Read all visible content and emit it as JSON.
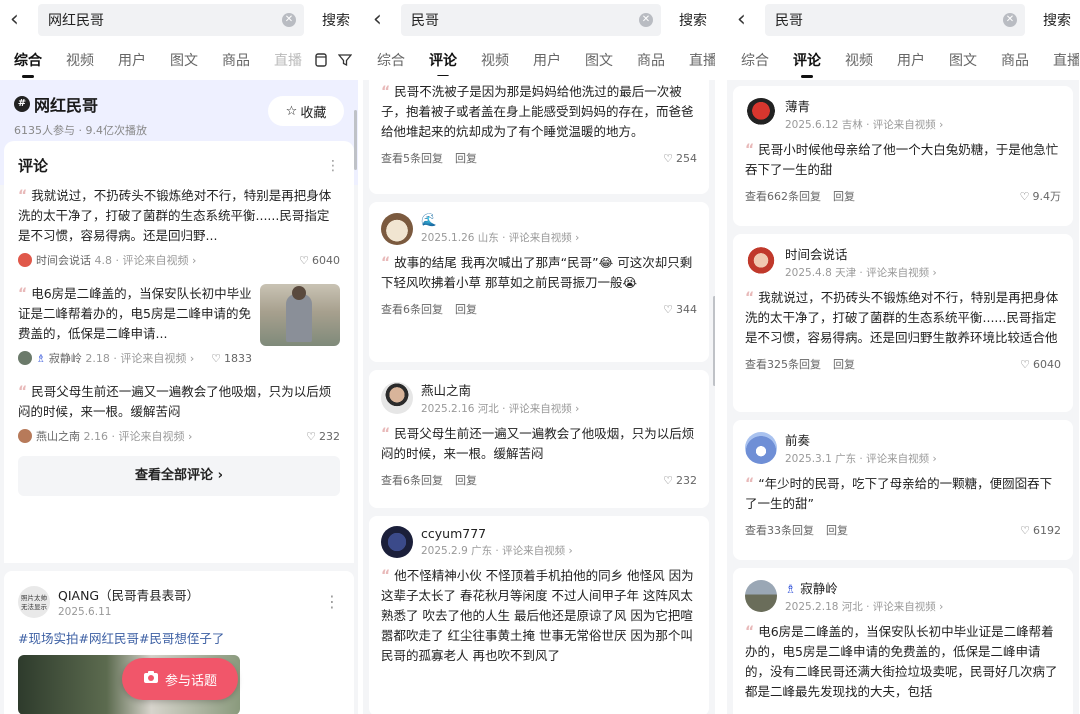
{
  "left": {
    "search": {
      "query": "网红民哥",
      "button": "搜索"
    },
    "tabs": [
      "综合",
      "视频",
      "用户",
      "图文",
      "商品",
      "直播"
    ],
    "topic": {
      "title": "网红民哥",
      "stats": "6135人参与 · 9.4亿次播放",
      "collect": "收藏"
    },
    "comment_section_title": "评论",
    "comments": [
      {
        "text": "我就说过，不扔砖头不锻炼绝对不行，特别是再把身体洗的太干净了，打破了菌群的生态系统平衡......民哥指定是不习惯，容易得病。还是回归野...",
        "user": "时间会说话",
        "meta": "4.8 · 评论来自视频",
        "likes": "6040"
      },
      {
        "text": "电6房是二峰盖的，当保安队长初中毕业证是二峰帮着办的，电5房是二峰申请的免费盖的，低保是二峰申请...",
        "user": "寂静岭",
        "meta": "2.18 · 评论来自视频",
        "likes": "1833"
      },
      {
        "text": "民哥父母生前还一遍又一遍教会了他吸烟，只为以后烦闷的时候，来一根。缓解苦闷",
        "user": "燕山之南",
        "meta": "2.16 · 评论来自视频",
        "likes": "232"
      }
    ],
    "view_all": "查看全部评论",
    "post": {
      "avatar_text": "照片太帅 无法显示",
      "user": "QIANG（民哥青县表哥）",
      "date": "2025.6.11",
      "hashtags": "#现场实拍#网红民哥#民哥想侄子了"
    },
    "join_button": "参与话题"
  },
  "middle": {
    "search": {
      "query": "民哥",
      "button": "搜索"
    },
    "tabs": [
      "综合",
      "评论",
      "视频",
      "用户",
      "图文",
      "商品",
      "直播"
    ],
    "active_tab": "评论",
    "comments": [
      {
        "user": "",
        "date": "",
        "text": "民哥不洗被子是因为那是妈妈给他洗过的最后一次被子，抱着被子或者盖在身上能感受到妈妈的存在，而爸爸给他堆起来的炕却成为了有个睡觉温暖的地方。",
        "replies": "查看5条回复",
        "reply": "回复",
        "likes": "254"
      },
      {
        "user": "🌊",
        "date": "2025.1.26 山东 · 评论来自视频",
        "text": "故事的结尾 我再次喊出了那声“民哥”😂 可这次却只剩下轻风吹拂着小草 那草如之前民哥振刀一般😭",
        "replies": "查看6条回复",
        "reply": "回复",
        "likes": "344"
      },
      {
        "user": "燕山之南",
        "date": "2025.2.16 河北 · 评论来自视频",
        "text": "民哥父母生前还一遍又一遍教会了他吸烟，只为以后烦闷的时候，来一根。缓解苦闷",
        "replies": "查看6条回复",
        "reply": "回复",
        "likes": "232"
      },
      {
        "user": "ccyum777",
        "date": "2025.2.9 广东 · 评论来自视频",
        "text": "他不怪精神小伙 不怪顶着手机拍他的同乡 他怪风 因为这辈子太长了 春花秋月等闲度 不过人间甲子年 这阵风太熟悉了 吹去了他的人生 最后他还是原谅了风 因为它把喧嚣都吹走了 红尘往事黄土掩 世事无常俗世厌 因为那个叫民哥的孤寡老人 再也吹不到风了",
        "replies": "",
        "reply": "",
        "likes": ""
      }
    ]
  },
  "right": {
    "search": {
      "query": "民哥",
      "button": "搜索"
    },
    "tabs": [
      "综合",
      "评论",
      "视频",
      "用户",
      "图文",
      "商品",
      "直播"
    ],
    "active_tab": "评论",
    "comments": [
      {
        "user": "薄青",
        "date": "2025.6.12 吉林 · 评论来自视频",
        "text": "民哥小时候他母亲给了他一个大白兔奶糖，于是他急忙吞下了一生的甜",
        "replies": "查看662条回复",
        "reply": "回复",
        "likes": "9.4万"
      },
      {
        "user": "时间会说话",
        "date": "2025.4.8 天津 · 评论来自视频",
        "text": "我就说过，不扔砖头不锻炼绝对不行，特别是再把身体洗的太干净了，打破了菌群的生态系统平衡......民哥指定是不习惯，容易得病。还是回归野生散养环境比较适合他",
        "replies": "查看325条回复",
        "reply": "回复",
        "likes": "6040"
      },
      {
        "user": "前奏",
        "date": "2025.3.1 广东 · 评论来自视频",
        "text": "“年少时的民哥，吃下了母亲给的一颗糖，便囫囵吞下了一生的甜”",
        "replies": "查看33条回复",
        "reply": "回复",
        "likes": "6192"
      },
      {
        "user": "寂静岭",
        "date": "2025.2.18 河北 · 评论来自视频",
        "text": "电6房是二峰盖的，当保安队长初中毕业证是二峰帮着办的，电5房是二峰申请的免费盖的，低保是二峰申请的，没有二峰民哥还满大街捡垃圾卖呢，民哥好几次病了都是二峰最先发现找的大夫，包括",
        "replies": "",
        "reply": "",
        "likes": ""
      }
    ]
  },
  "colors": {
    "accent_red": "#f1566a",
    "hashtag_blue": "#3c5fa3",
    "topic_bg": "#eef0ff"
  }
}
